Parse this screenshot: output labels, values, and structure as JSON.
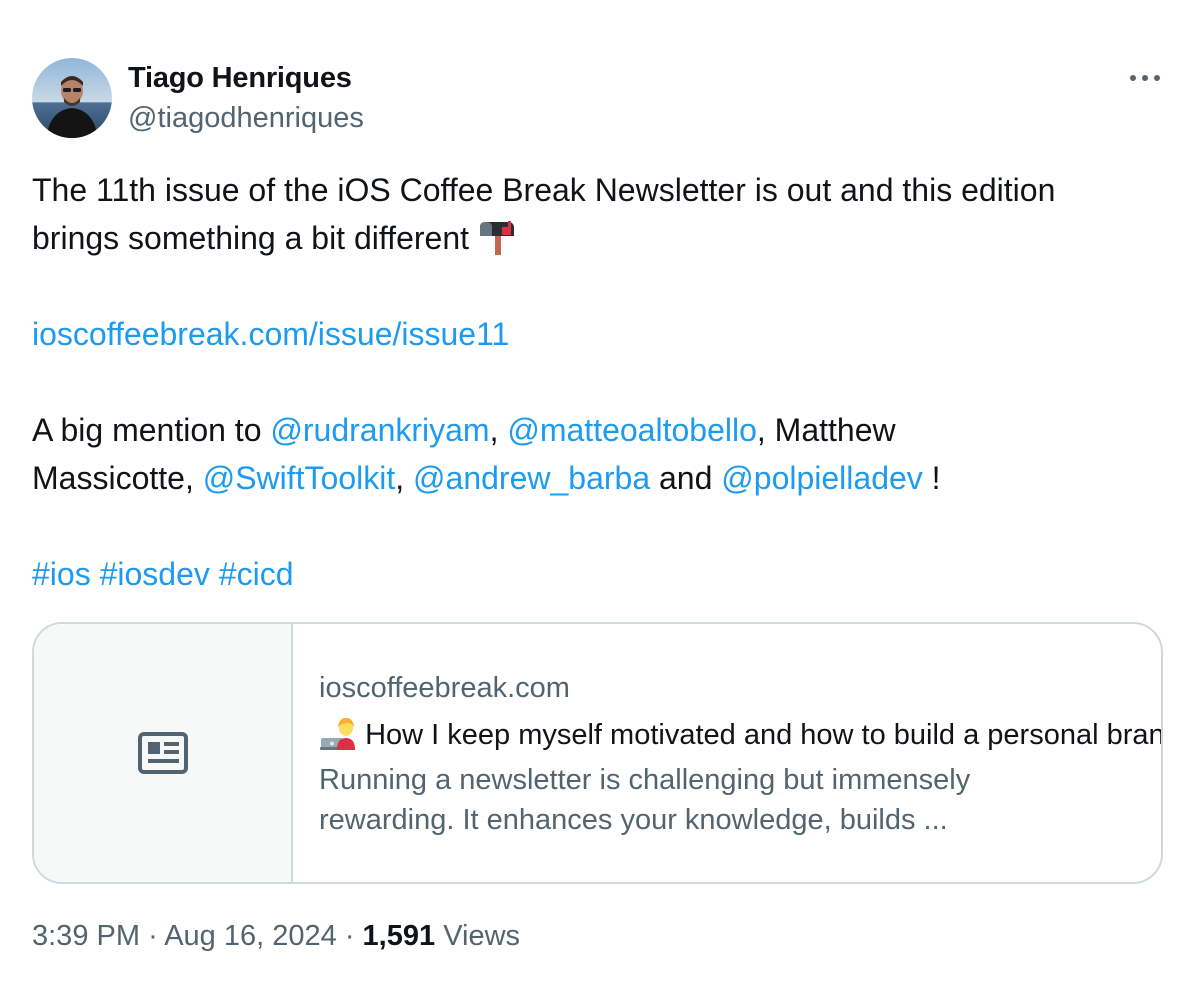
{
  "author": {
    "name": "Tiago Henriques",
    "handle": "@tiagodhenriques"
  },
  "tweet": {
    "line1": "The 11th issue of the iOS Coffee Break Newsletter is out and this edition",
    "line2": "brings something a bit different",
    "url": "ioscoffeebreak.com/issue/issue11",
    "mention_prefix": "A big mention to ",
    "mentions": {
      "m1": "@rudrankriyam",
      "m2": "@matteoaltobello",
      "m3": "@SwiftToolkit",
      "m4": "@andrew_barba",
      "m5": "@polpielladev"
    },
    "sep_comma": ", ",
    "plain_name_1": "Matthew",
    "plain_name_2": "Massicotte, ",
    "and_text": " and ",
    "end_text": " !",
    "hashtags": [
      "#ios",
      "#iosdev",
      "#cicd"
    ]
  },
  "card": {
    "domain": "ioscoffeebreak.com",
    "title": "How I keep myself motivated and how to build a personal brand",
    "description": "Running a newsletter is challenging but immensely rewarding. It enhances your knowledge, builds ..."
  },
  "meta": {
    "time": "3:39 PM",
    "separator": "·",
    "date": "Aug 16, 2024",
    "views_count": "1,591",
    "views_label": "Views"
  },
  "icons": {
    "more": "more-horizontal-icon",
    "mailbox": "mailbox-emoji-icon",
    "technologist": "technologist-emoji-icon",
    "card_placeholder": "newspaper-icon"
  },
  "colors": {
    "link": "#1d9bf0",
    "secondary_text": "#536471",
    "primary_text": "#0f1419",
    "border": "#cfd9de",
    "thumb_bg": "#f7f9f9"
  }
}
